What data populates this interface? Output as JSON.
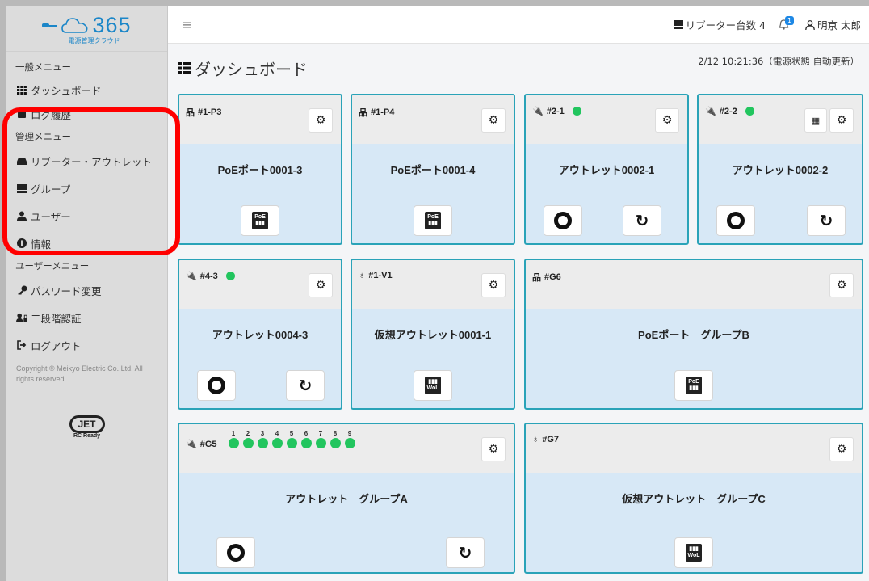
{
  "brand": {
    "logo_text": "365",
    "logo_sub": "電源管理クラウド"
  },
  "sidebar": {
    "general_label": "一般メニュー",
    "general_items": [
      {
        "label": "ダッシュボード",
        "icon": "grid-icon"
      },
      {
        "label": "ログ履歴",
        "icon": "log-icon"
      }
    ],
    "admin_label": "管理メニュー",
    "admin_items": [
      {
        "label": "リブーター・アウトレット",
        "icon": "device-icon"
      },
      {
        "label": "グループ",
        "icon": "group-icon"
      },
      {
        "label": "ユーザー",
        "icon": "user-icon"
      },
      {
        "label": "情報",
        "icon": "info-icon"
      }
    ],
    "user_label": "ユーザーメニュー",
    "user_items": [
      {
        "label": "パスワード変更",
        "icon": "key-icon"
      },
      {
        "label": "二段階認証",
        "icon": "two-factor-icon"
      },
      {
        "label": "ログアウト",
        "icon": "logout-icon"
      }
    ],
    "copyright": "Copyright © Meikyo Electric Co.,Ltd. All rights reserved.",
    "jet_logo": "JET",
    "jet_sub": "RC Ready"
  },
  "topbar": {
    "reboot_count": "リブーター台数 4",
    "notification_badge": "1",
    "user_name": "明京 太郎"
  },
  "main": {
    "title": "ダッシュボード",
    "timestamp": "2/12 10:21:36（電源状態 自動更新）"
  },
  "cards": [
    {
      "tag": "#1-P3",
      "title": "PoEポート0001-3"
    },
    {
      "tag": "#1-P4",
      "title": "PoEポート0001-4"
    },
    {
      "tag": "#2-1",
      "title": "アウトレット0002-1"
    },
    {
      "tag": "#2-2",
      "title": "アウトレット0002-2"
    },
    {
      "tag": "#4-3",
      "title": "アウトレット0004-3"
    },
    {
      "tag": "#1-V1",
      "title": "仮想アウトレット0001-1"
    },
    {
      "tag": "#G6",
      "title": "PoEポート　グループB"
    },
    {
      "tag": "#G5",
      "title": "アウトレット　グループA",
      "ports": [
        "1",
        "2",
        "3",
        "4",
        "5",
        "6",
        "7",
        "8",
        "9"
      ]
    },
    {
      "tag": "#G7",
      "title": "仮想アウトレット　グループC"
    }
  ],
  "icons": {
    "poe": "PoE",
    "wol": "WoL"
  },
  "colors": {
    "accent": "#2aa3b8",
    "status_on": "#22c55e",
    "card_body": "#d7e8f6",
    "highlight": "#ff0000"
  }
}
